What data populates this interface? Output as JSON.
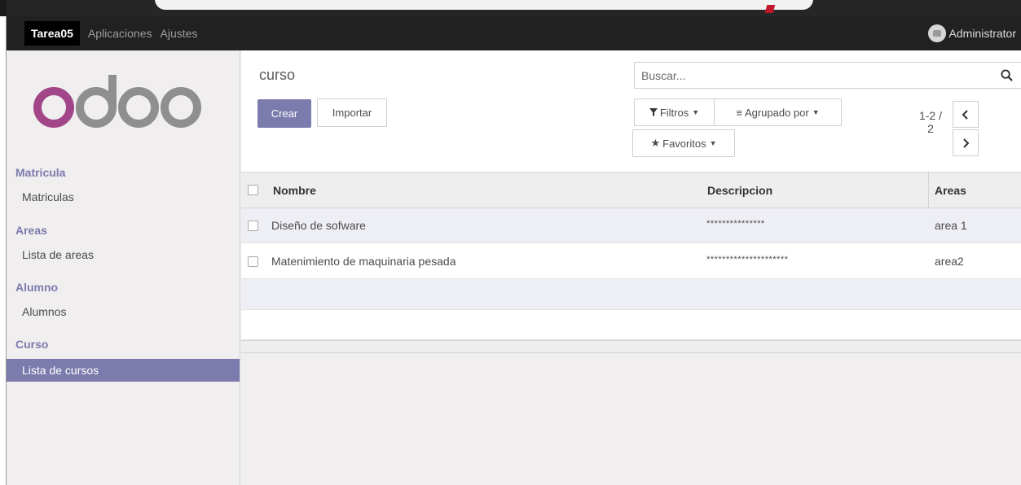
{
  "navbar": {
    "brand": "Tarea05",
    "links": [
      "Aplicaciones",
      "Ajustes"
    ],
    "user": "Administrator"
  },
  "sidebar": {
    "logo_text": "odoo",
    "sections": [
      {
        "header": "Matricula",
        "items": [
          {
            "label": "Matriculas",
            "active": false
          }
        ]
      },
      {
        "header": "Areas",
        "items": [
          {
            "label": "Lista de areas",
            "active": false
          }
        ]
      },
      {
        "header": "Alumno",
        "items": [
          {
            "label": "Alumnos",
            "active": false
          }
        ]
      },
      {
        "header": "Curso",
        "items": [
          {
            "label": "Lista de cursos",
            "active": true
          }
        ]
      }
    ]
  },
  "control_panel": {
    "title": "curso",
    "create_label": "Crear",
    "import_label": "Importar",
    "search_placeholder": "Buscar...",
    "filters_label": "Filtros",
    "groupby_label": "Agrupado por",
    "favorites_label": "Favoritos",
    "pager_line1": "1-2 /",
    "pager_line2": "2"
  },
  "list": {
    "columns": [
      "Nombre",
      "Descripcion",
      "Areas"
    ],
    "rows": [
      {
        "nombre": "Diseño de sofware",
        "descripcion": "***************",
        "areas": "area 1"
      },
      {
        "nombre": "Matenimiento de maquinaria pesada",
        "descripcion": "*********************",
        "areas": "area2"
      }
    ]
  },
  "colors": {
    "accent": "#7c7bad",
    "navbar": "#212121",
    "logo_o": "#a24689",
    "logo_gray": "#8f8f8f"
  }
}
